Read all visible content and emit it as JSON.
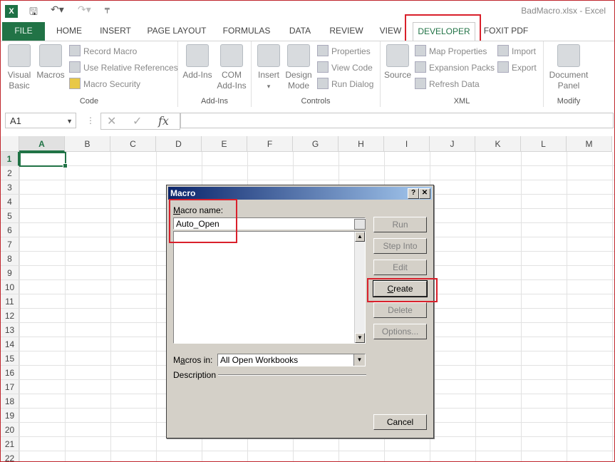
{
  "titlebar": {
    "app_icon": "excel-icon",
    "window_title": "BadMacro.xlsx - Excel"
  },
  "tabs": {
    "file": "FILE",
    "home": "HOME",
    "insert": "INSERT",
    "page_layout": "PAGE LAYOUT",
    "formulas": "FORMULAS",
    "data": "DATA",
    "review": "REVIEW",
    "view": "VIEW",
    "developer": "DEVELOPER",
    "foxit": "FOXIT PDF"
  },
  "ribbon": {
    "code": {
      "label": "Code",
      "visual_basic": "Visual Basic",
      "macros": "Macros",
      "record_macro": "Record Macro",
      "relative_refs": "Use Relative References",
      "macro_security": "Macro Security"
    },
    "addins": {
      "label": "Add-Ins",
      "addins": "Add-Ins",
      "com_addins": "COM Add-Ins"
    },
    "controls": {
      "label": "Controls",
      "insert": "Insert",
      "design_mode": "Design Mode",
      "properties": "Properties",
      "view_code": "View Code",
      "run_dialog": "Run Dialog"
    },
    "xml": {
      "label": "XML",
      "source": "Source",
      "map_properties": "Map Properties",
      "expansion_packs": "Expansion Packs",
      "refresh_data": "Refresh Data",
      "import": "Import",
      "export": "Export"
    },
    "modify": {
      "label": "Modify",
      "document_panel": "Document Panel"
    }
  },
  "formula_bar": {
    "name_box": "A1",
    "cancel_glyph": "✕",
    "enter_glyph": "✓",
    "fx_glyph": "fx",
    "value": ""
  },
  "grid": {
    "columns": [
      "A",
      "B",
      "C",
      "D",
      "E",
      "F",
      "G",
      "H",
      "I",
      "J",
      "K",
      "L",
      "M"
    ],
    "rows": [
      "1",
      "2",
      "3",
      "4",
      "5",
      "6",
      "7",
      "8",
      "9",
      "10",
      "11",
      "12",
      "13",
      "14",
      "15",
      "16",
      "17",
      "18",
      "19",
      "20",
      "21",
      "22"
    ],
    "active_cell": "A1"
  },
  "dialog": {
    "title": "Macro",
    "help_btn": "?",
    "close_btn": "✕",
    "macro_name_label_ul": "M",
    "macro_name_label_rest": "acro name:",
    "macro_name_value": "Auto_Open",
    "macros_in_label_pre": "M",
    "macros_in_label_ul": "a",
    "macros_in_label_rest": "cros in:",
    "macros_in_value": "All Open Workbooks",
    "description_label": "Description",
    "buttons": {
      "run": "Run",
      "step_into": "Step Into",
      "edit": "Edit",
      "create_ul": "C",
      "create_rest": "reate",
      "delete": "Delete",
      "options": "Options...",
      "cancel": "Cancel"
    }
  },
  "colors": {
    "excel_green": "#217346",
    "highlight_red": "#d9202b",
    "dialog_gray": "#d4d0c8",
    "dialog_title": "#0a246a"
  }
}
